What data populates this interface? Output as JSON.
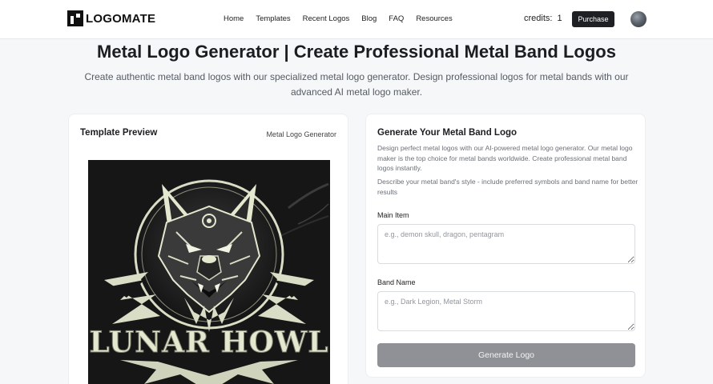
{
  "header": {
    "logo_text": "LOGOMATE",
    "nav": [
      "Home",
      "Templates",
      "Recent Logos",
      "Blog",
      "FAQ",
      "Resources"
    ],
    "credits_label": "credits:",
    "credits_value": "1",
    "purchase_label": "Purchase",
    "icons": [
      "logo-mark-icon",
      "avatar"
    ]
  },
  "hero": {
    "title": "Metal Logo Generator | Create Professional Metal Band Logos",
    "subtitle": "Create authentic metal band logos with our specialized metal logo generator. Design professional logos for metal bands with our advanced AI metal logo maker."
  },
  "preview": {
    "title": "Template Preview",
    "tag": "Metal Logo Generator",
    "image_text": "LUNAR HOWL"
  },
  "generator": {
    "title": "Generate Your Metal Band Logo",
    "description": "Design perfect metal logos with our AI-powered metal logo generator. Our metal logo maker is the top choice for metal bands worldwide. Create professional metal band logos instantly.",
    "hint": "Describe your metal band's style - include preferred symbols and band name for better results",
    "main_item": {
      "label": "Main Item",
      "value": "",
      "placeholder": "e.g., demon skull, dragon, pentagram"
    },
    "band_name": {
      "label": "Band Name",
      "value": "",
      "placeholder": "e.g., Dark Legion, Metal Storm"
    },
    "generate_label": "Generate Logo"
  },
  "colors": {
    "page_bg": "#f6f7f9",
    "purchase_bg": "#1e2024",
    "generate_bg": "#8f9196",
    "logo_bg": "#161616",
    "logo_ink": "#e4e8cf"
  }
}
